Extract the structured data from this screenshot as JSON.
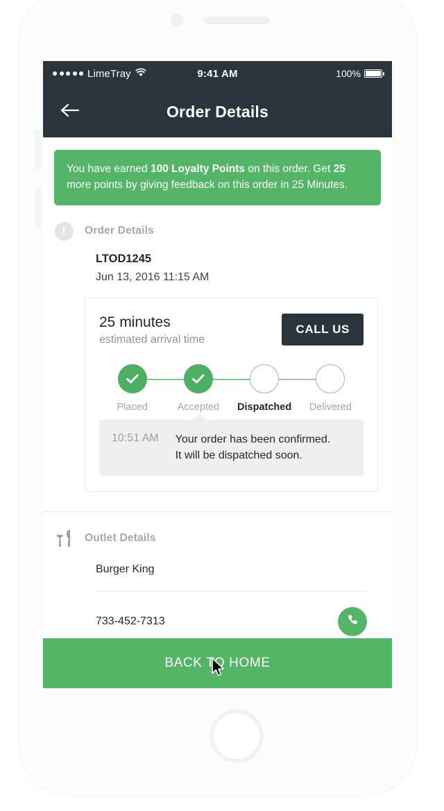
{
  "status_bar": {
    "carrier": "LimeTray",
    "signal_dots": 5,
    "wifi_icon": "wifi-icon",
    "time": "9:41 AM",
    "battery_percent": "100%",
    "battery_icon": "battery-full-icon"
  },
  "nav": {
    "back_icon": "back-arrow-icon",
    "title": "Order Details"
  },
  "banner": {
    "text_1": "You have earned ",
    "bold_1": "100 Loyalty Points",
    "text_2": " on this order. Get ",
    "bold_2": "25",
    "text_3": " more points by giving feedback on this order in 25 Minutes.",
    "color": "#54b567"
  },
  "order_section": {
    "icon": "info-icon",
    "icon_glyph": "i",
    "title": "Order Details",
    "order_id": "LTOD1245",
    "order_date": "Jun 13, 2016 11:15 AM"
  },
  "tracking": {
    "eta_value": "25 minutes",
    "eta_label": "estimated arrival time",
    "call_button": "CALL US",
    "steps": [
      {
        "label": "Placed",
        "state": "done"
      },
      {
        "label": "Accepted",
        "state": "done"
      },
      {
        "label": "Dispatched",
        "state": "active"
      },
      {
        "label": "Delivered",
        "state": "pending"
      }
    ],
    "message": {
      "time": "10:51 AM",
      "line_1": "Your order has been confirmed.",
      "line_2": "It will be dispatched soon."
    },
    "done_color": "#4caf62",
    "pending_color": "#a9aeb3"
  },
  "outlet_section": {
    "icon": "restaurant-cutlery-icon",
    "title": "Outlet Details",
    "name": "Burger King",
    "phone": "733-452-7313",
    "call_icon": "phone-handset-icon"
  },
  "cta": {
    "label": "BACK TO HOME",
    "color": "#54b567"
  },
  "device": {
    "camera_icon": "front-camera-icon",
    "speaker_icon": "earpiece-speaker-icon",
    "home_button_icon": "home-button-icon"
  }
}
